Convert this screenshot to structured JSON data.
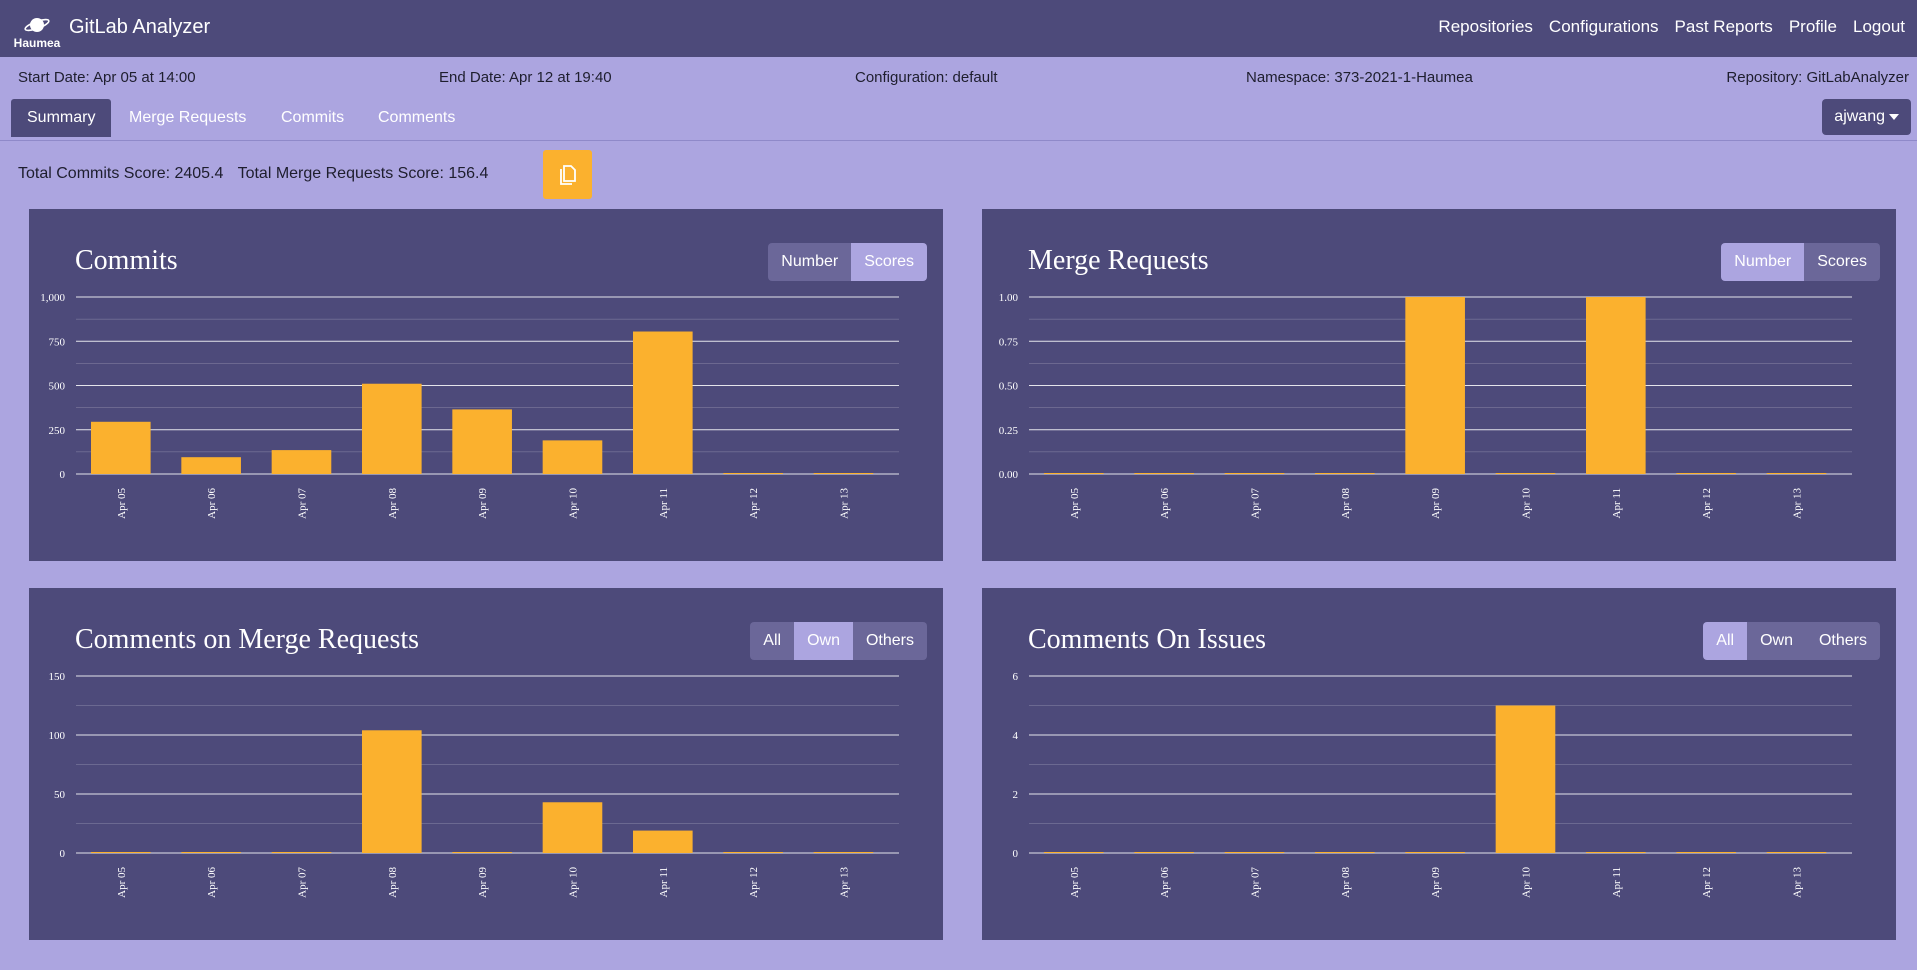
{
  "navbar": {
    "logo_text": "Haumea",
    "title": "GitLab Analyzer",
    "links": [
      "Repositories",
      "Configurations",
      "Past Reports",
      "Profile",
      "Logout"
    ]
  },
  "info": {
    "start": "Start Date: Apr 05 at 14:00",
    "end": "End Date: Apr 12 at 19:40",
    "config": "Configuration: default",
    "namespace": "Namespace: 373-2021-1-Haumea",
    "repo": "Repository: GitLabAnalyzer"
  },
  "tabs": [
    "Summary",
    "Merge Requests",
    "Commits",
    "Comments"
  ],
  "user": "ajwang",
  "scores": {
    "commits": "Total Commits Score: 2405.4",
    "mrs": "Total Merge Requests Score: 156.4"
  },
  "colors": {
    "bar": "#fbb12e",
    "panel": "#4d4a7a",
    "page": "#aca5e0"
  },
  "panels": {
    "commits": {
      "title": "Commits",
      "buttons": [
        "Number",
        "Scores"
      ],
      "active": 1
    },
    "mrs": {
      "title": "Merge Requests",
      "buttons": [
        "Number",
        "Scores"
      ],
      "active": 0
    },
    "mr_comments": {
      "title": "Comments on Merge Requests",
      "buttons": [
        "All",
        "Own",
        "Others"
      ],
      "active": 1
    },
    "issue_comments": {
      "title": "Comments On Issues",
      "buttons": [
        "All",
        "Own",
        "Others"
      ],
      "active": 0
    }
  },
  "chart_data": [
    {
      "type": "bar",
      "categories": [
        "Apr 05",
        "Apr 06",
        "Apr 07",
        "Apr 08",
        "Apr 09",
        "Apr 10",
        "Apr 11",
        "Apr 12",
        "Apr 13"
      ],
      "values": [
        295,
        95,
        135,
        510,
        365,
        190,
        805,
        0,
        0
      ],
      "ylim": [
        0,
        1000
      ],
      "yticks": [
        "0",
        "250",
        "500",
        "750",
        "1,000"
      ]
    },
    {
      "type": "bar",
      "categories": [
        "Apr 05",
        "Apr 06",
        "Apr 07",
        "Apr 08",
        "Apr 09",
        "Apr 10",
        "Apr 11",
        "Apr 12",
        "Apr 13"
      ],
      "values": [
        0,
        0,
        0,
        0,
        1,
        0,
        1,
        0,
        0
      ],
      "ylim": [
        0,
        1
      ],
      "yticks": [
        "0.00",
        "0.25",
        "0.50",
        "0.75",
        "1.00"
      ]
    },
    {
      "type": "bar",
      "categories": [
        "Apr 05",
        "Apr 06",
        "Apr 07",
        "Apr 08",
        "Apr 09",
        "Apr 10",
        "Apr 11",
        "Apr 12",
        "Apr 13"
      ],
      "values": [
        0,
        0,
        0,
        104,
        0,
        43,
        19,
        0,
        0
      ],
      "ylim": [
        0,
        150
      ],
      "yticks": [
        "0",
        "50",
        "100",
        "150"
      ]
    },
    {
      "type": "bar",
      "categories": [
        "Apr 05",
        "Apr 06",
        "Apr 07",
        "Apr 08",
        "Apr 09",
        "Apr 10",
        "Apr 11",
        "Apr 12",
        "Apr 13"
      ],
      "values": [
        0,
        0,
        0,
        0,
        0,
        5,
        0,
        0,
        0
      ],
      "ylim": [
        0,
        6
      ],
      "yticks": [
        "0",
        "2",
        "4",
        "6"
      ]
    }
  ]
}
